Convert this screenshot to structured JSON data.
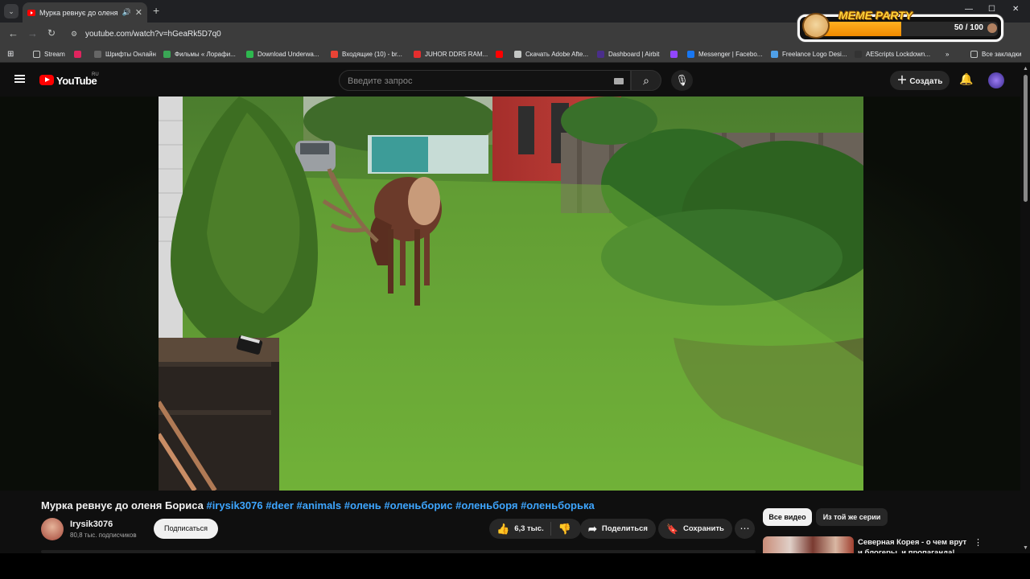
{
  "browser": {
    "tab_title": "Мурка ревнує до оленя Бо",
    "url": "youtube.com/watch?v=hGeaRk5D7q0",
    "meme_party": {
      "brand": "MEME PARTY",
      "count": "50 / 100",
      "progress": 0.5
    }
  },
  "bookmarks": [
    {
      "label": "Stream",
      "icon": "folder-icon",
      "color": "#c4c7c5"
    },
    {
      "label": "",
      "icon": "app-icon",
      "color": "#e0245e"
    },
    {
      "label": "Шрифты Онлайн",
      "icon": "font-icon",
      "color": "#666666"
    },
    {
      "label": "Фильмы « Лорафи...",
      "icon": "film-icon",
      "color": "#3aa655"
    },
    {
      "label": "Download Underwa...",
      "icon": "download-icon",
      "color": "#2eb84f"
    },
    {
      "label": "Входящие (10) - br...",
      "icon": "gmail-icon",
      "color": "#ea4335"
    },
    {
      "label": "JUHOR DDR5 RAM...",
      "icon": "shop-icon",
      "color": "#e62e2e"
    },
    {
      "label": "",
      "icon": "youtube-icon",
      "color": "#ff0000"
    },
    {
      "label": "Скачать Adobe Afte...",
      "icon": "globe-icon",
      "color": "#c4c7c5"
    },
    {
      "label": "Dashboard | Airbit",
      "icon": "airbit-icon",
      "color": "#4a2e8a"
    },
    {
      "label": "",
      "icon": "twitch-icon",
      "color": "#9146ff"
    },
    {
      "label": "Messenger | Facebo...",
      "icon": "facebook-icon",
      "color": "#1877f2"
    },
    {
      "label": "Freelance Logo Desi...",
      "icon": "gear-icon",
      "color": "#4fa0e8"
    },
    {
      "label": "AEScripts Lockdown...",
      "icon": "ae-icon",
      "color": "#333333"
    }
  ],
  "bookmarks_all": "Все закладки",
  "yt": {
    "logo_text": "YouTube",
    "region": "RU",
    "search_placeholder": "Введите запрос",
    "create_label": "Создать"
  },
  "video": {
    "title": "Мурка ревнує до оленя Бориса",
    "hashtags": "#irysik3076 #deer #animals #олень #оленьборис #оленьборя #оленьборька",
    "channel_name": "Irysik3076",
    "subscribers": "80,8 тыс. подписчиков",
    "subscribe_label": "Подписаться",
    "likes": "6,3 тыс.",
    "share_label": "Поделиться",
    "save_label": "Сохранить"
  },
  "sidebar": {
    "chips": [
      "Все видео",
      "Из той же серии"
    ],
    "rec_title": "Северная Корея - о чем врут и блогеры, и пропаганда!"
  }
}
